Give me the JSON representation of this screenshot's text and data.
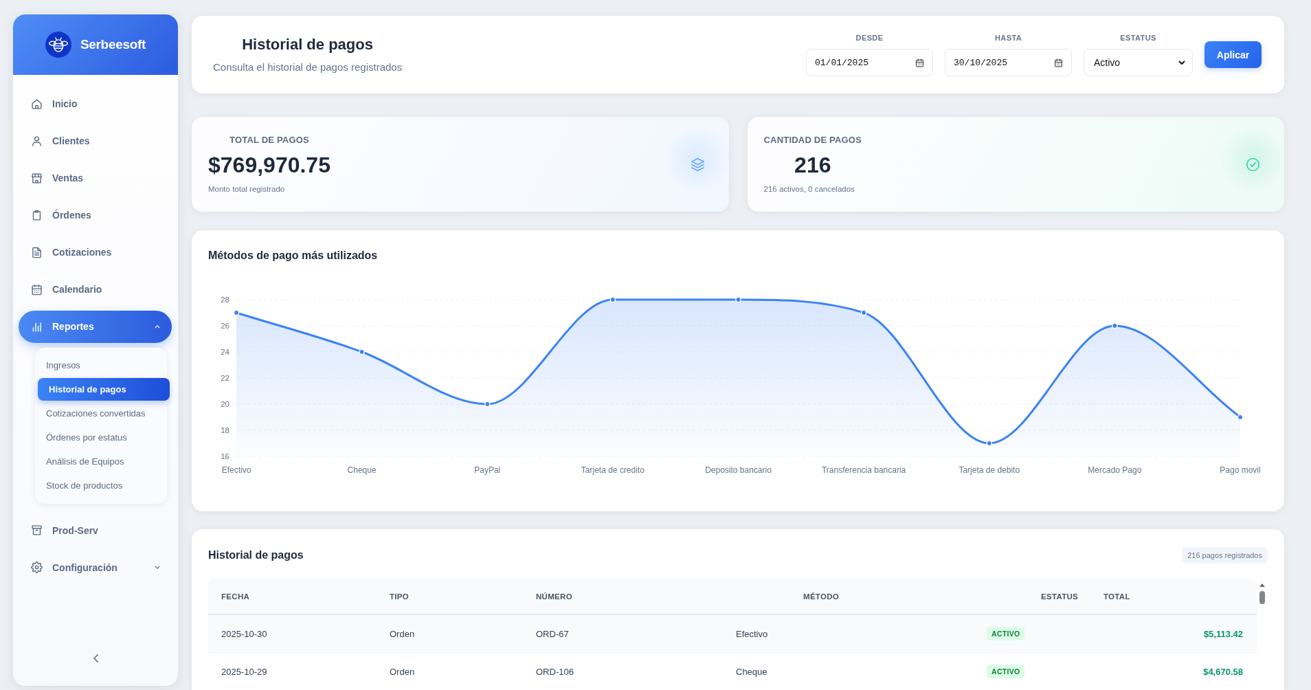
{
  "sidebar": {
    "brand": "Serbeesoft",
    "items": [
      {
        "label": "Inicio",
        "selected": false
      },
      {
        "label": "Clientes",
        "selected": false
      },
      {
        "label": "Ventas",
        "selected": false
      },
      {
        "label": "Órdenes",
        "selected": false
      },
      {
        "label": "Cotizaciones",
        "selected": false
      },
      {
        "label": "Calendario",
        "selected": false
      },
      {
        "label": "Reportes",
        "selected": true,
        "expanded": true,
        "children": [
          {
            "label": "Ingresos",
            "selected": false
          },
          {
            "label": "Historial de pagos",
            "selected": true
          },
          {
            "label": "Cotizaciones convertidas",
            "selected": false
          },
          {
            "label": "Órdenes por estatus",
            "selected": false
          },
          {
            "label": "Análisis de Equipos",
            "selected": false
          },
          {
            "label": "Stock de productos",
            "selected": false
          }
        ]
      },
      {
        "label": "Prod-Serv",
        "selected": false
      },
      {
        "label": "Configuración",
        "selected": false,
        "expanded": false
      }
    ]
  },
  "header": {
    "title": "Historial de pagos",
    "subtitle": "Consulta el historial de pagos registrados",
    "filters": [
      {
        "kind": "date",
        "label": "DESDE",
        "value": "01/01/2025"
      },
      {
        "kind": "date",
        "label": "HASTA",
        "value": "30/10/2025"
      },
      {
        "kind": "select",
        "label": "ESTATUS",
        "value": "Activo"
      }
    ],
    "button": "Aplicar"
  },
  "stats": [
    {
      "label": "TOTAL DE PAGOS",
      "value": "$769,970.75",
      "note": "Monto total registrado",
      "color": "#60a5fa"
    },
    {
      "label": "CANTIDAD DE PAGOS",
      "value": "216",
      "note": "216 activos, 0 cancelados",
      "color": "#34d399"
    }
  ],
  "chart_card": {
    "chart_data": {
      "type": "area",
      "title": "Métodos de pago más utilizados",
      "categories": [
        "Efectivo",
        "Cheque",
        "PayPal",
        "Tarjeta de credito",
        "Deposito bancario",
        "Transferencia bancaria",
        "Tarjeta de debito",
        "Mercado Pago",
        "Pago movil"
      ],
      "series": [
        {
          "color": "#3b82f6",
          "values": [
            27,
            24,
            20,
            28,
            28,
            27,
            17,
            26,
            19
          ]
        }
      ],
      "ylim": [
        16,
        28
      ],
      "yticks": [
        16,
        18,
        20,
        22,
        24,
        26,
        28
      ],
      "grid": true
    }
  },
  "table": {
    "title": "Historial de pagos",
    "count": "216 pagos registrados",
    "columns": [
      "FECHA",
      "TIPO",
      "NÚMERO",
      "MÉTODO",
      "ESTATUS",
      "TOTAL"
    ],
    "rows": [
      {
        "fecha": "2025-10-30",
        "tipo": "Orden",
        "numero": "ORD-67",
        "metodo": "Efectivo",
        "estatus": "ACTIVO",
        "total": "$5,113.42"
      },
      {
        "fecha": "2025-10-29",
        "tipo": "Orden",
        "numero": "ORD-106",
        "metodo": "Cheque",
        "estatus": "ACTIVO",
        "total": "$4,670.58"
      }
    ]
  }
}
